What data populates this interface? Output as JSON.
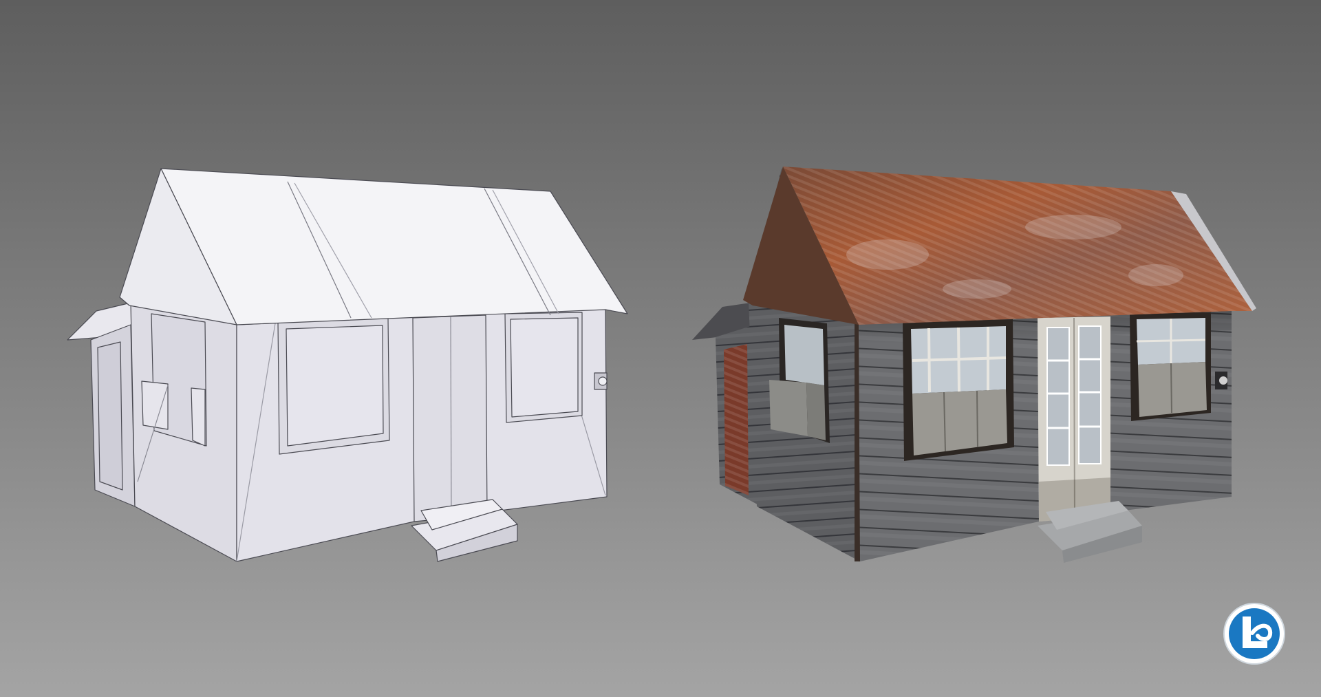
{
  "scene": {
    "background_top": "#5e5e5e",
    "background_bottom": "#a4a4a4",
    "models": [
      {
        "name": "untextured-house-model",
        "style": "clay render",
        "color": "#e3e2ea"
      },
      {
        "name": "textured-house-model",
        "style": "textured render",
        "roof_color": "#9a4a2c",
        "wall_color": "#6a6a6c",
        "door_color": "#d8d6d0"
      }
    ],
    "logo": {
      "icon": "studio-logo-icon",
      "letter": "L",
      "color": "#1a78c2"
    }
  }
}
